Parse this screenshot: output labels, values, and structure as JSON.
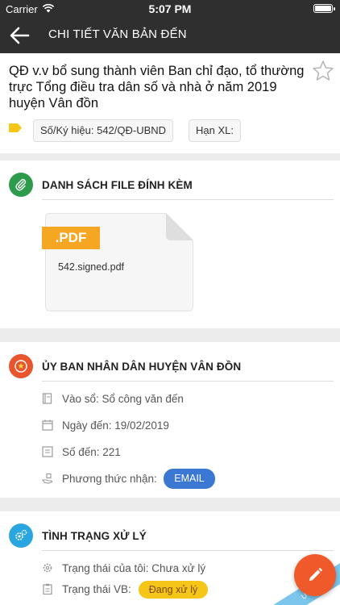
{
  "status_bar": {
    "carrier": "Carrier",
    "time": "5:07 PM"
  },
  "header": {
    "title": "CHI TIẾT VĂN BẢN ĐẾN"
  },
  "document": {
    "title": "QĐ v.v bổ sung thành viên Ban chỉ đạo, tổ thường trực Tổng điều tra dân số và nhà ở năm 2019 huyện Vân đồn",
    "symbol_chip": "Số/Ký hiệu: 542/QĐ-UBND",
    "deadline_chip": "Hạn XL:"
  },
  "attachments": {
    "title": "DANH SÁCH FILE ĐÍNH KÈM",
    "files": [
      {
        "badge": ".PDF",
        "name": "542.signed.pdf"
      }
    ]
  },
  "sender": {
    "title": "ỦY BAN NHÂN DÂN HUYỆN VÂN ĐỒN",
    "book": "Vào sổ:  Sổ công văn đến",
    "date": "Ngày đến:  19/02/2019",
    "number": "Số đến:  221",
    "method_label": "Phương thức nhận:",
    "method_value": "EMAIL"
  },
  "processing": {
    "title": "TÌNH TRẠNG XỬ LÝ",
    "my_status": "Trạng thái của tôi: Chưa xử lý",
    "doc_status_label": "Trạng thái VB:",
    "doc_status_value": "Đang xử lý",
    "stamp": "ƯỜNG"
  },
  "colors": {
    "header_bg": "#2f2f2f",
    "attachment_icon": "#2e9b4c",
    "sender_icon": "#e8542c",
    "processing_icon": "#29a6df",
    "email_pill": "#3a78d4",
    "status_pill": "#f5c518",
    "fab": "#f0592a",
    "file_badge": "#f5a623"
  },
  "icons": {
    "back": "arrow-left-icon",
    "favorite": "star-outline-icon",
    "tag": "tag-icon",
    "attachments": "paperclip-icon",
    "sender": "emblem-icon",
    "processing": "gears-icon",
    "book": "book-icon",
    "date": "calendar-icon",
    "number": "number-icon",
    "method": "hand-icon",
    "my_status": "gear-icon",
    "doc_status": "clipboard-icon",
    "edit": "pencil-icon"
  }
}
